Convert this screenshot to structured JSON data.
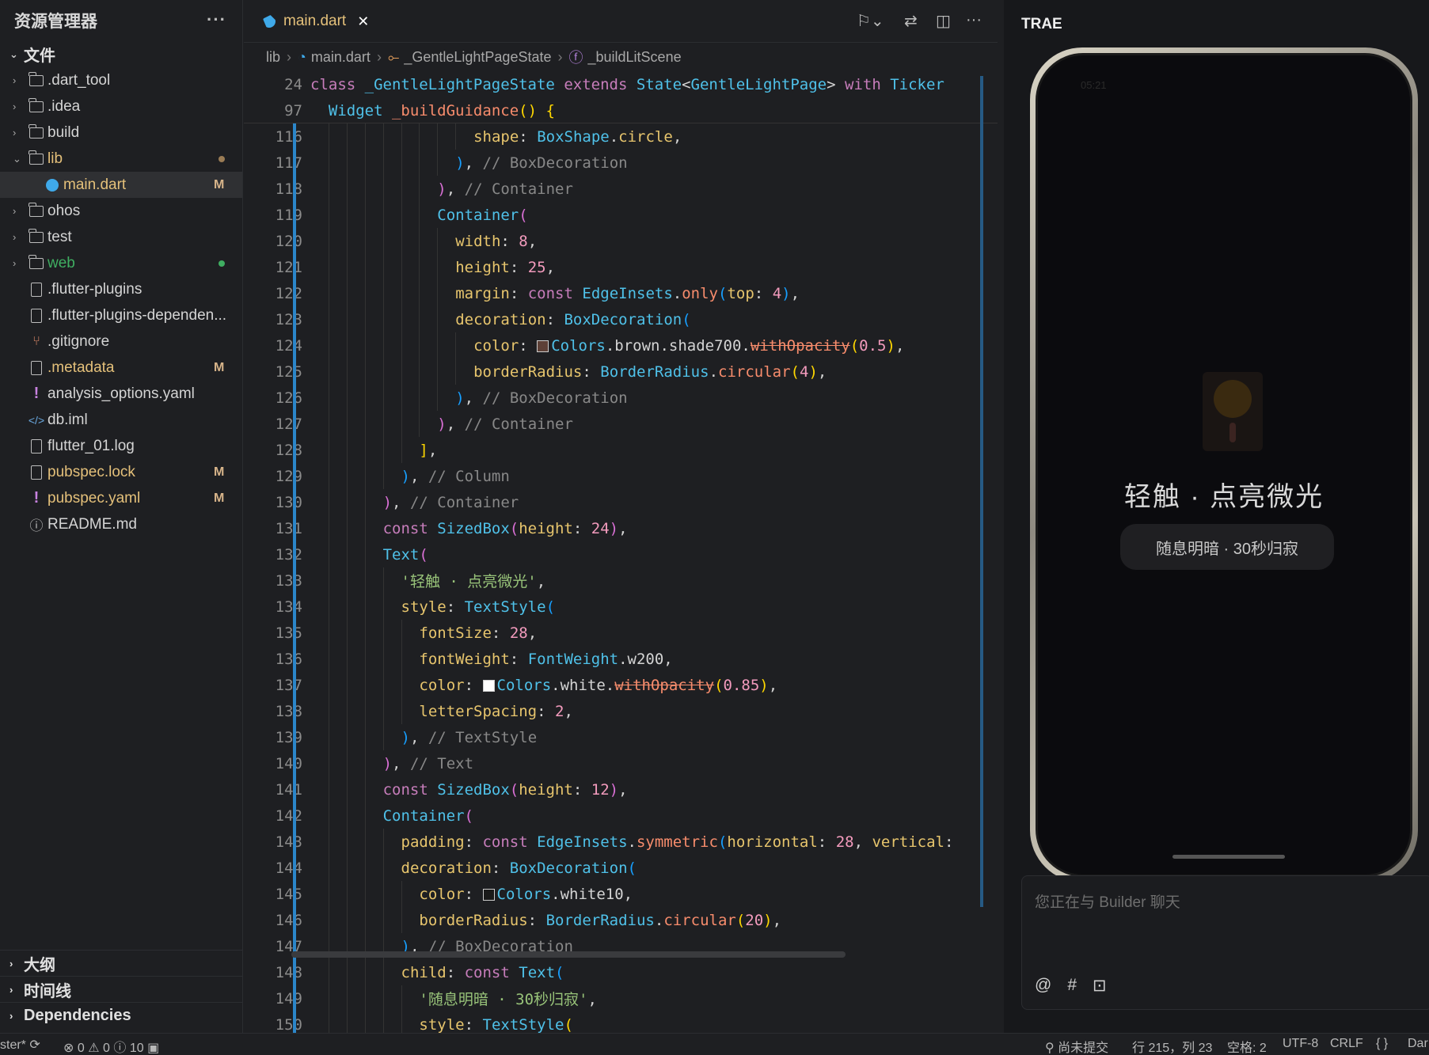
{
  "sidebar": {
    "title": "资源管理器",
    "more": "···",
    "section": "文件",
    "items": [
      {
        "label": ".dart_tool",
        "type": "folder",
        "chev": "›"
      },
      {
        "label": ".idea",
        "type": "folder",
        "chev": "›"
      },
      {
        "label": "build",
        "type": "folder",
        "chev": "›"
      },
      {
        "label": "lib",
        "type": "folder-open",
        "chev": "⌄",
        "dot": "#9a7c55",
        "class": "lbl-modified"
      },
      {
        "label": "main.dart",
        "type": "dart",
        "badge": "M",
        "class": "lbl-modified",
        "active": true
      },
      {
        "label": "ohos",
        "type": "folder",
        "chev": "›"
      },
      {
        "label": "test",
        "type": "folder",
        "chev": "›"
      },
      {
        "label": "web",
        "type": "folder",
        "chev": "›",
        "dot": "#3fae61",
        "class": "lbl-green"
      },
      {
        "label": ".flutter-plugins",
        "type": "file"
      },
      {
        "label": ".flutter-plugins-dependen...",
        "type": "file"
      },
      {
        "label": ".gitignore",
        "type": "git"
      },
      {
        "label": ".metadata",
        "type": "file",
        "badge": "M",
        "class": "lbl-modified"
      },
      {
        "label": "analysis_options.yaml",
        "type": "yaml"
      },
      {
        "label": "db.iml",
        "type": "xml"
      },
      {
        "label": "flutter_01.log",
        "type": "file"
      },
      {
        "label": "pubspec.lock",
        "type": "file",
        "badge": "M",
        "class": "lbl-modified"
      },
      {
        "label": "pubspec.yaml",
        "type": "yaml",
        "badge": "M",
        "class": "lbl-modified"
      },
      {
        "label": "README.md",
        "type": "info"
      }
    ],
    "bottom_sections": [
      "大纲",
      "时间线",
      "Dependencies"
    ]
  },
  "editor": {
    "tab_label": "main.dart",
    "breadcrumb": [
      "lib",
      "main.dart",
      "_GentleLightPageState",
      "_buildLitScene"
    ],
    "lines": [
      {
        "n": "24",
        "ind": 0,
        "html": "<span class='k'>class</span> <span class='c'>_GentleLightPageState</span> <span class='k'>extends</span> <span class='c'>State</span><span class='w'>&lt;</span><span class='c'>GentleLightPage</span><span class='w'>&gt;</span> <span class='k'>with</span> <span class='c'>Ticker</span>"
      },
      {
        "n": "97",
        "ind": 1,
        "html": "<span class='c'>Widget</span> <span class='f'>_buildGuidance</span><span class='br1'>()</span> <span class='br1'>{</span>"
      },
      {
        "n": "116",
        "ind": 9,
        "html": "<span class='p'>shape</span><span class='w'>:</span> <span class='c'>BoxShape</span><span class='w'>.</span><span class='p'>circle</span><span class='w'>,</span>"
      },
      {
        "n": "117",
        "ind": 8,
        "html": "<span class='br3'>)</span><span class='w'>,</span> <span class='m'>// BoxDecoration</span>"
      },
      {
        "n": "118",
        "ind": 7,
        "html": "<span class='br2'>)</span><span class='w'>,</span> <span class='m'>// Container</span>"
      },
      {
        "n": "119",
        "ind": 7,
        "html": "<span class='c'>Container</span><span class='br2'>(</span>"
      },
      {
        "n": "120",
        "ind": 8,
        "html": "<span class='p'>width</span><span class='w'>:</span> <span class='n'>8</span><span class='w'>,</span>"
      },
      {
        "n": "121",
        "ind": 8,
        "html": "<span class='p'>height</span><span class='w'>:</span> <span class='n'>25</span><span class='w'>,</span>"
      },
      {
        "n": "122",
        "ind": 8,
        "html": "<span class='p'>margin</span><span class='w'>:</span> <span class='k'>const</span> <span class='c'>EdgeInsets</span><span class='w'>.</span><span class='f'>only</span><span class='br3'>(</span><span class='p'>top</span><span class='w'>:</span> <span class='n'>4</span><span class='br3'>)</span><span class='w'>,</span>"
      },
      {
        "n": "123",
        "ind": 8,
        "html": "<span class='p'>decoration</span><span class='w'>:</span> <span class='c'>BoxDecoration</span><span class='br3'>(</span>"
      },
      {
        "n": "124",
        "ind": 9,
        "html": "<span class='p'>color</span><span class='w'>:</span> <span class='swatch' style='background:#5d4037'></span><span class='c'>Colors</span><span class='w'>.brown.shade700.</span><span class='strike'>withOpacity</span><span class='br1'>(</span><span class='n'>0.5</span><span class='br1'>)</span><span class='w'>,</span>"
      },
      {
        "n": "125",
        "ind": 9,
        "html": "<span class='p'>borderRadius</span><span class='w'>:</span> <span class='c'>BorderRadius</span><span class='w'>.</span><span class='f'>circular</span><span class='br1'>(</span><span class='n'>4</span><span class='br1'>)</span><span class='w'>,</span>"
      },
      {
        "n": "126",
        "ind": 8,
        "html": "<span class='br3'>)</span><span class='w'>,</span> <span class='m'>// BoxDecoration</span>"
      },
      {
        "n": "127",
        "ind": 7,
        "html": "<span class='br2'>)</span><span class='w'>,</span> <span class='m'>// Container</span>"
      },
      {
        "n": "128",
        "ind": 6,
        "html": "<span class='br1'>]</span><span class='w'>,</span>"
      },
      {
        "n": "129",
        "ind": 5,
        "html": "<span class='br3'>)</span><span class='w'>,</span> <span class='m'>// Column</span>"
      },
      {
        "n": "130",
        "ind": 4,
        "html": "<span class='br2'>)</span><span class='w'>,</span> <span class='m'>// Container</span>"
      },
      {
        "n": "131",
        "ind": 4,
        "html": "<span class='k'>const</span> <span class='c'>SizedBox</span><span class='br2'>(</span><span class='p'>height</span><span class='w'>:</span> <span class='n'>24</span><span class='br2'>)</span><span class='w'>,</span>"
      },
      {
        "n": "132",
        "ind": 4,
        "html": "<span class='c'>Text</span><span class='br2'>(</span>"
      },
      {
        "n": "133",
        "ind": 5,
        "html": "<span class='s'>'轻触 · 点亮微光'</span><span class='w'>,</span>"
      },
      {
        "n": "134",
        "ind": 5,
        "html": "<span class='p'>style</span><span class='w'>:</span> <span class='c'>TextStyle</span><span class='br3'>(</span>"
      },
      {
        "n": "135",
        "ind": 6,
        "html": "<span class='p'>fontSize</span><span class='w'>:</span> <span class='n'>28</span><span class='w'>,</span>"
      },
      {
        "n": "136",
        "ind": 6,
        "html": "<span class='p'>fontWeight</span><span class='w'>:</span> <span class='c'>FontWeight</span><span class='w'>.w200,</span>"
      },
      {
        "n": "137",
        "ind": 6,
        "html": "<span class='p'>color</span><span class='w'>:</span> <span class='swatch' style='background:#ffffff'></span><span class='c'>Colors</span><span class='w'>.white.</span><span class='strike'>withOpacity</span><span class='br1'>(</span><span class='n'>0.85</span><span class='br1'>)</span><span class='w'>,</span>"
      },
      {
        "n": "138",
        "ind": 6,
        "html": "<span class='p'>letterSpacing</span><span class='w'>:</span> <span class='n'>2</span><span class='w'>,</span>"
      },
      {
        "n": "139",
        "ind": 5,
        "html": "<span class='br3'>)</span><span class='w'>,</span> <span class='m'>// TextStyle</span>"
      },
      {
        "n": "140",
        "ind": 4,
        "html": "<span class='br2'>)</span><span class='w'>,</span> <span class='m'>// Text</span>"
      },
      {
        "n": "141",
        "ind": 4,
        "html": "<span class='k'>const</span> <span class='c'>SizedBox</span><span class='br2'>(</span><span class='p'>height</span><span class='w'>:</span> <span class='n'>12</span><span class='br2'>)</span><span class='w'>,</span>"
      },
      {
        "n": "142",
        "ind": 4,
        "html": "<span class='c'>Container</span><span class='br2'>(</span>"
      },
      {
        "n": "143",
        "ind": 5,
        "html": "<span class='p'>padding</span><span class='w'>:</span> <span class='k'>const</span> <span class='c'>EdgeInsets</span><span class='w'>.</span><span class='f'>symmetric</span><span class='br3'>(</span><span class='p'>horizontal</span><span class='w'>:</span> <span class='n'>28</span><span class='w'>,</span> <span class='p'>vertical</span><span class='w'>:</span>"
      },
      {
        "n": "144",
        "ind": 5,
        "html": "<span class='p'>decoration</span><span class='w'>:</span> <span class='c'>BoxDecoration</span><span class='br3'>(</span>"
      },
      {
        "n": "145",
        "ind": 6,
        "html": "<span class='p'>color</span><span class='w'>:</span> <span class='swatch' style='background:#1a1a1a'></span><span class='c'>Colors</span><span class='w'>.white10,</span>"
      },
      {
        "n": "146",
        "ind": 6,
        "html": "<span class='p'>borderRadius</span><span class='w'>:</span> <span class='c'>BorderRadius</span><span class='w'>.</span><span class='f'>circular</span><span class='br1'>(</span><span class='n'>20</span><span class='br1'>)</span><span class='w'>,</span>"
      },
      {
        "n": "147",
        "ind": 5,
        "html": "<span class='br3'>)</span><span class='w'>,</span> <span class='m'>// BoxDecoration</span>"
      },
      {
        "n": "148",
        "ind": 5,
        "html": "<span class='p'>child</span><span class='w'>:</span> <span class='k'>const</span> <span class='c'>Text</span><span class='br3'>(</span>"
      },
      {
        "n": "149",
        "ind": 6,
        "html": "<span class='s'>'随息明暗 · 30秒归寂'</span><span class='w'>,</span>"
      },
      {
        "n": "150",
        "ind": 6,
        "html": "<span class='p'>style</span><span class='w'>:</span> <span class='c'>TextStyle</span><span class='br1'>(</span>"
      }
    ]
  },
  "right_panel": {
    "title": "TRAE",
    "phone": {
      "status_time": "05:21",
      "headline": "轻触 · 点亮微光",
      "pill": "随息明暗 · 30秒归寂"
    },
    "chat_placeholder": "您正在与 Builder 聊天",
    "chat_tools": [
      "@",
      "#",
      "⊡"
    ]
  },
  "statusbar": {
    "branch": "ster*",
    "errors": "0",
    "warnings": "0",
    "infos": "10",
    "commit": "尚未提交",
    "position": "行 215，列 23",
    "spaces": "空格: 2",
    "encoding": "UTF-8",
    "eol": "CRLF",
    "braces": "{ }",
    "lang": "Dar"
  }
}
